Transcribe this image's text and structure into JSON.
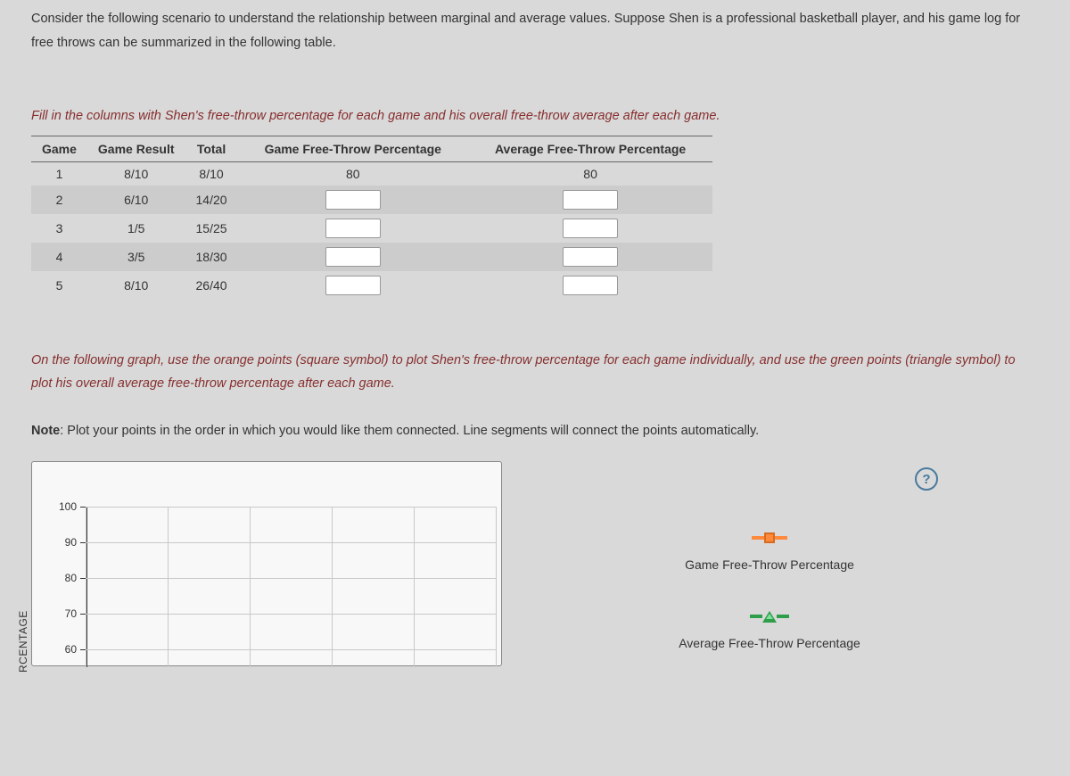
{
  "intro": "Consider the following scenario to understand the relationship between marginal and average values. Suppose Shen is a professional basketball player, and his game log for free throws can be summarized in the following table.",
  "instruction1": "Fill in the columns with Shen's free-throw percentage for each game and his overall free-throw average after each game.",
  "table": {
    "headers": [
      "Game",
      "Game Result",
      "Total",
      "Game Free-Throw Percentage",
      "Average Free-Throw Percentage"
    ],
    "rows": [
      {
        "game": "1",
        "result": "8/10",
        "total": "8/10",
        "game_pct": "80",
        "avg_pct": "80",
        "input": false
      },
      {
        "game": "2",
        "result": "6/10",
        "total": "14/20",
        "game_pct": "",
        "avg_pct": "",
        "input": true
      },
      {
        "game": "3",
        "result": "1/5",
        "total": "15/25",
        "game_pct": "",
        "avg_pct": "",
        "input": true
      },
      {
        "game": "4",
        "result": "3/5",
        "total": "18/30",
        "game_pct": "",
        "avg_pct": "",
        "input": true
      },
      {
        "game": "5",
        "result": "8/10",
        "total": "26/40",
        "game_pct": "",
        "avg_pct": "",
        "input": true
      }
    ]
  },
  "instruction2": "On the following graph, use the orange points (square symbol) to plot Shen's free-throw percentage for each game individually, and use the green points (triangle symbol) to plot his overall average free-throw percentage after each game.",
  "note_label": "Note",
  "note_text": ": Plot your points in the order in which you would like them connected. Line segments will connect the points automatically.",
  "help_label": "?",
  "legend": {
    "series1": "Game Free-Throw Percentage",
    "series2": "Average Free-Throw Percentage"
  },
  "chart_data": {
    "type": "line",
    "ylabel": "RCENTAGE",
    "y_ticks": [
      100,
      90,
      80,
      70,
      60
    ],
    "ylim": [
      60,
      100
    ],
    "series": [
      {
        "name": "Game Free-Throw Percentage",
        "symbol": "square",
        "color": "#ff8a3c",
        "values": []
      },
      {
        "name": "Average Free-Throw Percentage",
        "symbol": "triangle",
        "color": "#2e9e4a",
        "values": []
      }
    ]
  }
}
